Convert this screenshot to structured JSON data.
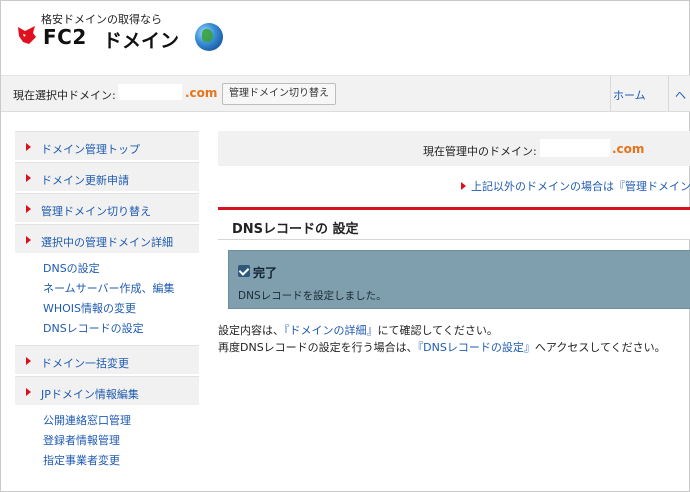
{
  "header": {
    "tagline": "格安ドメインの取得なら",
    "brand": "FC2",
    "brand_suffix": "ドメイン"
  },
  "domain_bar": {
    "label": "現在選択中ドメイン:",
    "tld": ".com",
    "switch_button": "管理ドメイン切り替え",
    "nav": {
      "home": "ホーム",
      "help": "ヘ"
    }
  },
  "sidebar": {
    "items": [
      {
        "label": "ドメイン管理トップ"
      },
      {
        "label": "ドメイン更新申請"
      },
      {
        "label": "管理ドメイン切り替え"
      },
      {
        "label": "選択中の管理ドメイン詳細"
      }
    ],
    "sub_links_1": [
      "DNSの設定",
      "ネームサーバー作成、編集",
      "WHOIS情報の変更",
      "DNSレコードの設定"
    ],
    "items2": [
      {
        "label": "ドメイン一括変更"
      },
      {
        "label": "JPドメイン情報編集"
      }
    ],
    "sub_links_2": [
      "公開連絡窓口管理",
      "登録者情報管理",
      "指定事業者変更"
    ]
  },
  "main": {
    "current_label": "現在管理中のドメイン:",
    "tld": ".com",
    "other_link": "上記以外のドメインの場合は『管理ドメイン切",
    "section_title": "DNSレコードの 設定",
    "alert": {
      "title": "完了",
      "message": "DNSレコードを設定しました。"
    },
    "info": {
      "line1_prefix": "設定内容は、",
      "line1_link": "『ドメインの詳細』",
      "line1_suffix": "にて確認してください。",
      "line2_prefix": "再度DNSレコードの設定を行う場合は、",
      "line2_link": "『DNSレコードの設定』",
      "line2_suffix": "へアクセスしてください。"
    }
  },
  "colors": {
    "accent_red": "#d9111e",
    "link_blue": "#1f5bb0",
    "tld_orange": "#e8731a"
  }
}
